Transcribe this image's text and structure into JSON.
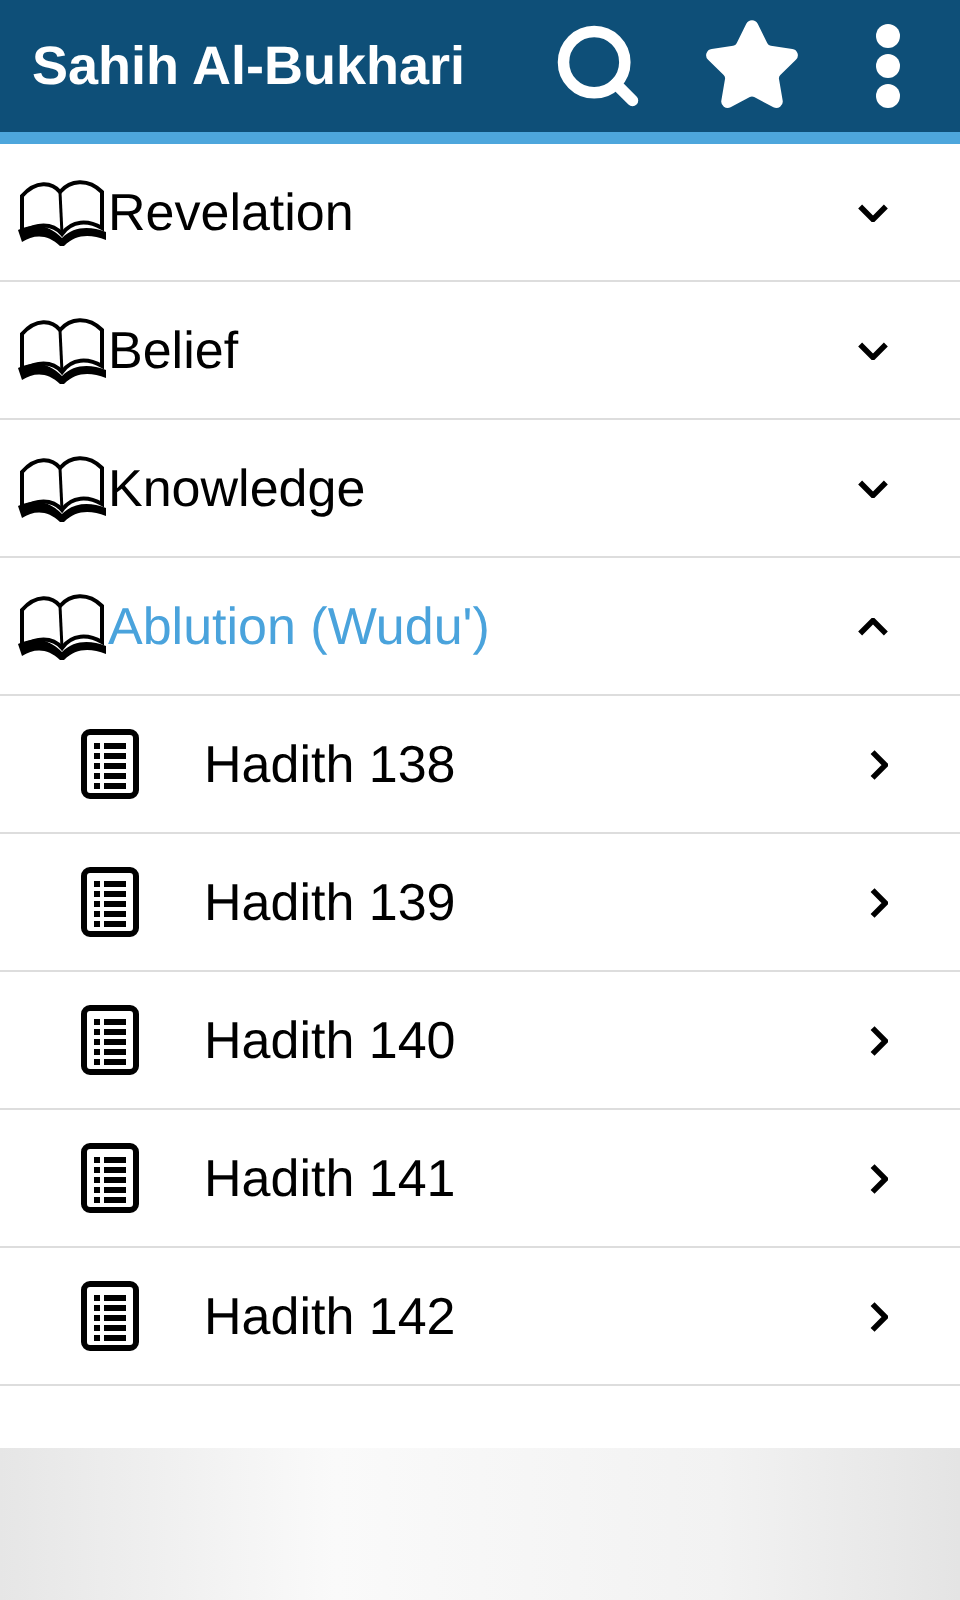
{
  "app_bar": {
    "title": "Sahih Al-Bukhari"
  },
  "chapters": [
    {
      "title": "Revelation",
      "expanded": false
    },
    {
      "title": "Belief",
      "expanded": false
    },
    {
      "title": "Knowledge",
      "expanded": false
    },
    {
      "title": "Ablution (Wudu')",
      "expanded": true,
      "hadiths": [
        {
          "title": "Hadith 138"
        },
        {
          "title": "Hadith 139"
        },
        {
          "title": "Hadith 140"
        },
        {
          "title": "Hadith 141"
        },
        {
          "title": "Hadith 142"
        }
      ]
    }
  ]
}
